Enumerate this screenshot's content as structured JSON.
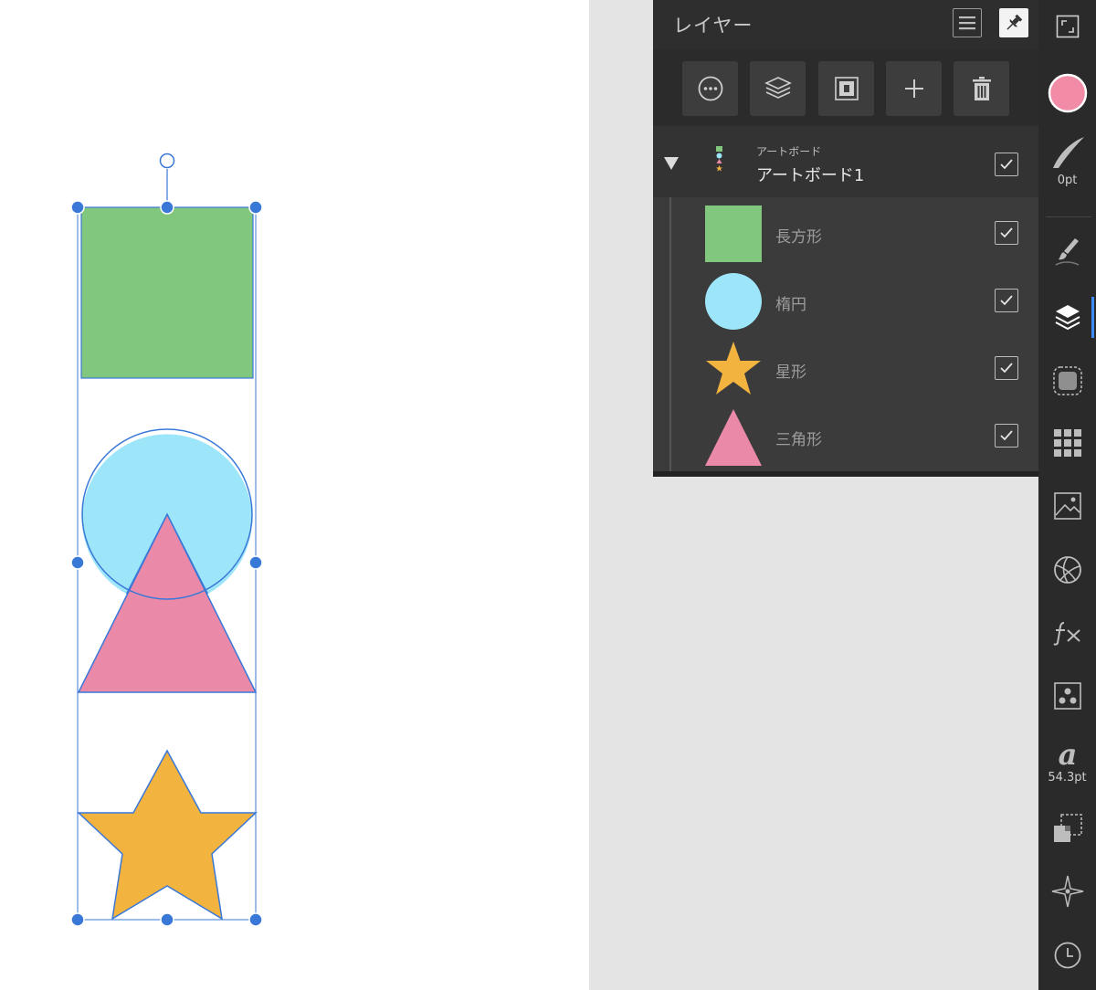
{
  "layers_panel": {
    "title": "レイヤー",
    "artboard": {
      "type_label": "アートボード",
      "name": "アートボード1"
    },
    "layers": [
      {
        "name": "長方形",
        "thumb": "rectangle",
        "color": "#81c77d"
      },
      {
        "name": "楕円",
        "thumb": "ellipse",
        "color": "#9de6fa"
      },
      {
        "name": "星形",
        "thumb": "star",
        "color": "#f3b33f"
      },
      {
        "name": "三角形",
        "thumb": "triangle",
        "color": "#eb89a8"
      }
    ]
  },
  "toolbar": {
    "buttons": [
      "more-options",
      "layer-stack",
      "mask",
      "add-layer",
      "delete-layer"
    ]
  },
  "studio": {
    "fill_color": "#f18ba6",
    "stroke_width": "0pt",
    "font_size": "54.3pt"
  },
  "colors": {
    "selection": "#3a78d8",
    "rectangle": "#81c77d",
    "ellipse": "#9de6fa",
    "triangle": "#eb89a8",
    "star": "#f3b33f"
  }
}
